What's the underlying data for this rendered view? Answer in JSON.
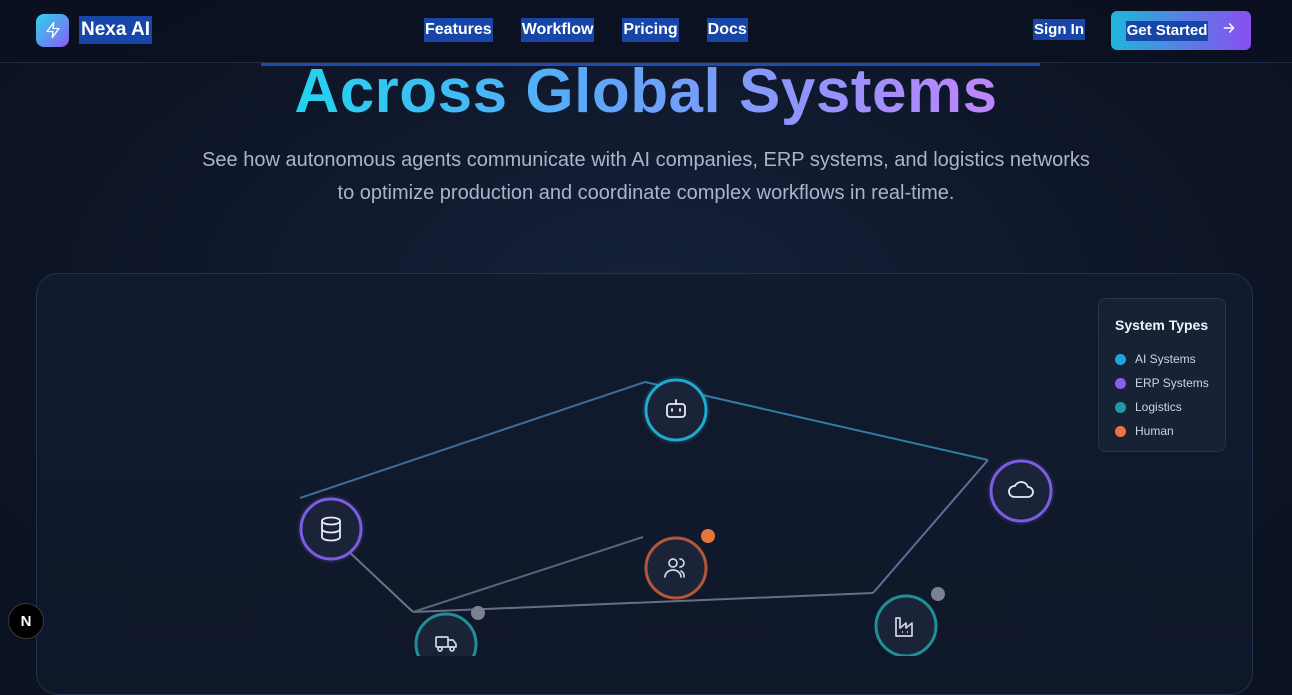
{
  "header": {
    "brand": "Nexa AI",
    "logo_icon": "lightning-icon",
    "nav": [
      {
        "label": "Features"
      },
      {
        "label": "Workflow"
      },
      {
        "label": "Pricing"
      },
      {
        "label": "Docs"
      }
    ],
    "sign_in": "Sign In",
    "cta": "Get Started",
    "cta_icon": "arrow-right-icon"
  },
  "hero": {
    "title": "Across Global Systems",
    "subtitle": "See how autonomous agents communicate with AI companies, ERP systems, and logistics networks to optimize production and coordinate complex workflows in real-time."
  },
  "legend": {
    "title": "System Types",
    "items": [
      {
        "label": "AI Systems",
        "color": "#1ea5dc"
      },
      {
        "label": "ERP Systems",
        "color": "#8b5cf6"
      },
      {
        "label": "Logistics",
        "color": "#1f9aa5"
      },
      {
        "label": "Human",
        "color": "#e8763a"
      }
    ]
  },
  "network_nodes": [
    {
      "name": "ai-bot-node",
      "icon": "bot-icon",
      "type": "AI Systems"
    },
    {
      "name": "cloud-node",
      "icon": "cloud-icon",
      "type": "ERP Systems"
    },
    {
      "name": "database-node",
      "icon": "database-icon",
      "type": "ERP Systems"
    },
    {
      "name": "human-node",
      "icon": "users-icon",
      "type": "Human"
    },
    {
      "name": "truck-node",
      "icon": "truck-icon",
      "type": "Logistics"
    },
    {
      "name": "factory-node",
      "icon": "factory-icon",
      "type": "Logistics"
    }
  ],
  "colors": {
    "accent_cyan": "#22d3ee",
    "accent_purple": "#8b5cf6",
    "background": "#0d1527"
  },
  "dev_badge": "N"
}
